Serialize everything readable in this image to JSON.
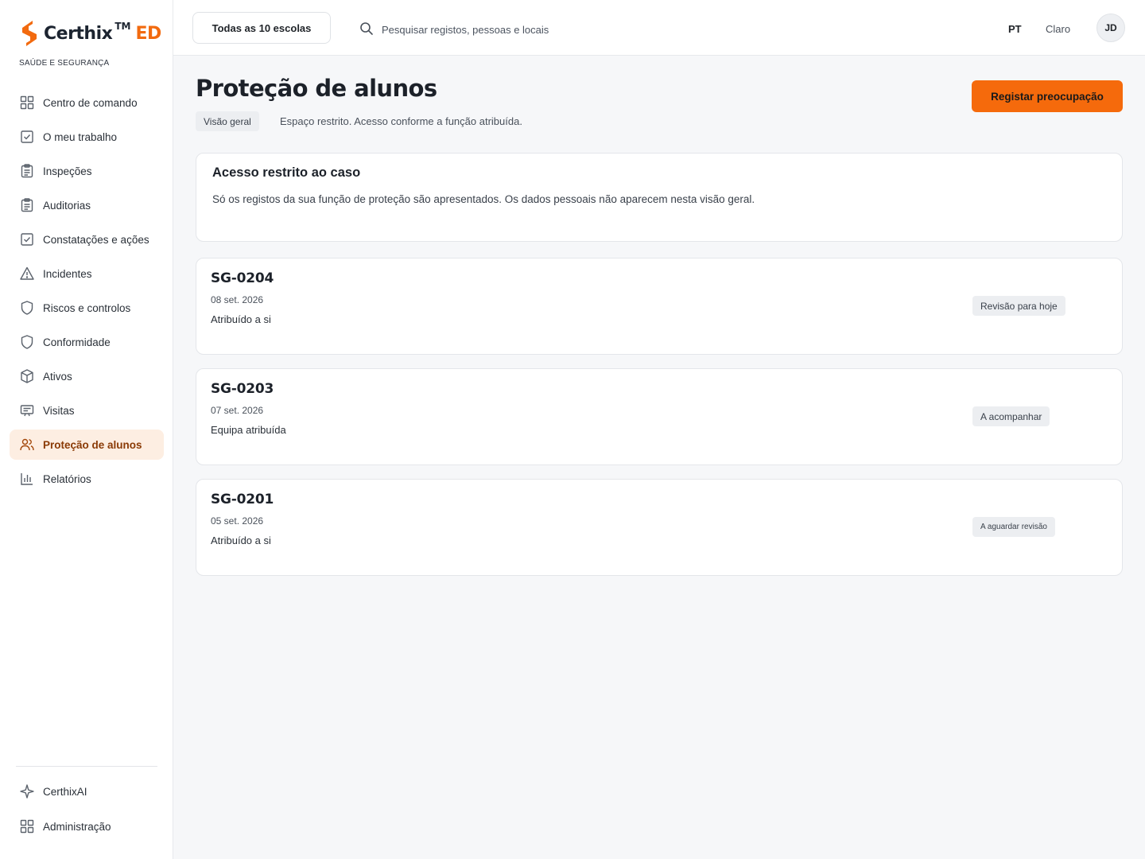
{
  "brand": {
    "name": "Certhix",
    "tm": "TM",
    "suffix": "ED",
    "subtitle": "SAÚDE E SEGURANÇA",
    "accent_color": "#f26a0f"
  },
  "sidebar": {
    "items": [
      {
        "label": "Centro de comando",
        "icon": "grid-icon"
      },
      {
        "label": "O meu trabalho",
        "icon": "checkbox-icon"
      },
      {
        "label": "Inspeções",
        "icon": "clipboard-icon"
      },
      {
        "label": "Auditorias",
        "icon": "clipboard-icon"
      },
      {
        "label": "Constatações e ações",
        "icon": "checkbox-icon"
      },
      {
        "label": "Incidentes",
        "icon": "warning-icon"
      },
      {
        "label": "Riscos e controlos",
        "icon": "shield-icon"
      },
      {
        "label": "Conformidade",
        "icon": "shield-icon"
      },
      {
        "label": "Ativos",
        "icon": "cube-icon"
      },
      {
        "label": "Visitas",
        "icon": "badge-icon"
      },
      {
        "label": "Proteção de alunos",
        "icon": "users-icon",
        "active": true
      },
      {
        "label": "Relatórios",
        "icon": "bar-chart-icon"
      }
    ],
    "bottom": [
      {
        "label": "CerthixAI",
        "icon": "sparkle-icon"
      },
      {
        "label": "Administração",
        "icon": "grid-icon"
      }
    ]
  },
  "topbar": {
    "school_selector": "Todas as 10 escolas",
    "search_placeholder": "Pesquisar registos, pessoas e locais",
    "language": "PT",
    "theme": "Claro",
    "avatar_initials": "JD"
  },
  "page": {
    "title": "Proteção de alunos",
    "breadcrumb_tag": "Visão geral",
    "breadcrumb_text": "Espaço restrito. Acesso conforme a função atribuída.",
    "primary_action": "Registar preocupação"
  },
  "notice": {
    "title": "Acesso restrito ao caso",
    "text": "Só os registos da sua função de proteção são apresentados. Os dados pessoais não aparecem nesta visão geral."
  },
  "cases": [
    {
      "id": "SG-0204",
      "date": "08 set. 2026",
      "assignment": "Atribuído a si",
      "status": "Revisão para hoje"
    },
    {
      "id": "SG-0203",
      "date": "07 set. 2026",
      "assignment": "Equipa atribuída",
      "status": "A acompanhar"
    },
    {
      "id": "SG-0201",
      "date": "05 set. 2026",
      "assignment": "Atribuído a si",
      "status": "A aguardar revisão"
    }
  ]
}
